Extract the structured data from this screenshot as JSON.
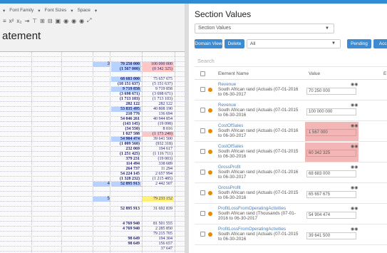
{
  "toolbar": {
    "font_family_label": "Font Family",
    "font_sizes_label": "Font Sizes",
    "space_label": "Space"
  },
  "document": {
    "title": "atement",
    "rows": [
      {
        "c1": "",
        "v1": "",
        "v2": "",
        "h1": "",
        "h2": ""
      },
      {
        "c1": "",
        "v1": "",
        "v2": "",
        "h1": "",
        "h2": ""
      },
      {
        "c1": "3",
        "v1": "70 250 000",
        "v2": "100 000 000",
        "h1": "blue",
        "h2": "pink"
      },
      {
        "c1": "",
        "v1": "(1 567 000)",
        "v2": "(0 342 325)",
        "h1": "blue",
        "h2": "pink"
      },
      {
        "c1": "",
        "v1": "",
        "v2": "",
        "h1": "",
        "h2": ""
      },
      {
        "c1": "",
        "v1": "68 683 000",
        "v2": "75 657 675",
        "h1": "blue",
        "h2": ""
      },
      {
        "c1": "",
        "v1": "(18 151 637)",
        "v2": "(5 151 637)",
        "h1": "",
        "h2": ""
      },
      {
        "c1": "",
        "v1": "9 719 858",
        "v2": "9 719 858",
        "h1": "blue",
        "h2": ""
      },
      {
        "c1": "",
        "v1": "(3 698 671)",
        "v2": "(3 698 671)",
        "h1": "",
        "h2": ""
      },
      {
        "c1": "",
        "v1": "(1 713 103)",
        "v2": "(1 713 103)",
        "h1": "",
        "h2": ""
      },
      {
        "c1": "",
        "v1": "282 122",
        "v2": "282 122",
        "h1": "",
        "h2": ""
      },
      {
        "c1": "",
        "v1": "53 835 495",
        "v2": "40 808 190",
        "h1": "blue",
        "h2": ""
      },
      {
        "c1": "",
        "v1": "210 776",
        "v2": "136 694",
        "h1": "",
        "h2": ""
      },
      {
        "c1": "",
        "v1": "54 046 261",
        "v2": "40 944 854",
        "h1": "",
        "h2": ""
      },
      {
        "c1": "",
        "v1": "(143 145)",
        "v2": "(19 098)",
        "h1": "",
        "h2": ""
      },
      {
        "c1": "",
        "v1": "(34 550)",
        "v2": "8 016",
        "h1": "",
        "h2": ""
      },
      {
        "c1": "",
        "v1": "1 027 588",
        "v2": "(1 173 240)",
        "h1": "",
        "h2": "pink"
      },
      {
        "c1": "",
        "v1": "54 904 474",
        "v2": "39 641 500",
        "h1": "blue",
        "h2": ""
      },
      {
        "c1": "",
        "v1": "(1 009 560)",
        "v2": "(932 318)",
        "h1": "",
        "h2": ""
      },
      {
        "c1": "",
        "v1": "232 069",
        "v2": "194 617",
        "h1": "",
        "h2": ""
      },
      {
        "c1": "",
        "v1": "(1 251 425)",
        "v2": "(1 116 711)",
        "h1": "",
        "h2": ""
      },
      {
        "c1": "",
        "v1": "379 231",
        "v2": "(19 003)",
        "h1": "",
        "h2": ""
      },
      {
        "c1": "",
        "v1": "114 494",
        "v2": "338 689",
        "h1": "",
        "h2": ""
      },
      {
        "c1": "",
        "v1": "264 737",
        "v2": "11 294",
        "h1": "",
        "h2": ""
      },
      {
        "c1": "",
        "v1": "54 224 145",
        "v2": "2 657 994",
        "h1": "",
        "h2": ""
      },
      {
        "c1": "",
        "v1": "(1 328 232)",
        "v2": "(1 215 485)",
        "h1": "",
        "h2": ""
      },
      {
        "c1": "4",
        "v1": "52 895 913",
        "v2": "2 442 507",
        "h1": "blue",
        "h2": ""
      },
      {
        "c1": "",
        "v1": "",
        "v2": "",
        "h1": "",
        "h2": ""
      },
      {
        "c1": "",
        "v1": "",
        "v2": "",
        "h1": "",
        "h2": ""
      },
      {
        "c1": "5",
        "v1": "",
        "v2": "79 233 152",
        "h1": "",
        "h2": "yellow"
      },
      {
        "c1": "",
        "v1": "",
        "v2": "",
        "h1": "",
        "h2": ""
      },
      {
        "c1": "",
        "v1": "52 895 913",
        "v2": "31 692 839",
        "h1": "",
        "h2": ""
      },
      {
        "c1": "",
        "v1": "",
        "v2": "",
        "h1": "",
        "h2": ""
      },
      {
        "c1": "",
        "v1": "",
        "v2": "",
        "h1": "",
        "h2": ""
      },
      {
        "c1": "",
        "v1": "4 769 940",
        "v2": "81 501 555",
        "h1": "",
        "h2": ""
      },
      {
        "c1": "",
        "v1": "4 769 940",
        "v2": "2 285 850",
        "h1": "",
        "h2": ""
      },
      {
        "c1": "",
        "v1": "",
        "v2": "79 215 705",
        "h1": "",
        "h2": ""
      },
      {
        "c1": "",
        "v1": "98 649",
        "v2": "194 304",
        "h1": "",
        "h2": ""
      },
      {
        "c1": "",
        "v1": "98 649",
        "v2": "156 657",
        "h1": "",
        "h2": ""
      },
      {
        "c1": "",
        "v1": "",
        "v2": "37 647",
        "h1": "",
        "h2": ""
      }
    ]
  },
  "panel": {
    "title": "Section Values",
    "section_select": "Section Values",
    "buttons": {
      "domain_view": "Domain View",
      "delete": "Delete",
      "pending": "Pending",
      "accept": "Acce"
    },
    "filter_select": "All",
    "search_placeholder": "Search",
    "columns": {
      "element_name": "Element Name",
      "value": "Value",
      "extra": "E"
    },
    "rows": [
      {
        "name": "Revenue",
        "desc": "South African rand (Actuals (07-01-2016 to 06-30-2017",
        "value": "70 250 000",
        "red": false
      },
      {
        "name": "Revenue",
        "desc": "South African rand (Actuals (07-01-2015 to 06-30-2016",
        "value": "100 000 000",
        "red": false
      },
      {
        "name": "CostOfSales",
        "desc": "South African rand (Actuals (07-01-2016 to 06-30-2017",
        "value": "1 567 000",
        "red": true
      },
      {
        "name": "CostOfSales",
        "desc": "South African rand (Actuals (07-01-2015 to 06-30-2016",
        "value": "60 342 325",
        "red": true
      },
      {
        "name": "GrossProfit",
        "desc": "South African rand (Actuals (07-01-2016 to 06-30-2017",
        "value": "68 683 000",
        "red": false
      },
      {
        "name": "GrossProfit",
        "desc": "South African rand (Actuals (07-01-2015 to 06-30-2016",
        "value": "65 657 675",
        "red": false
      },
      {
        "name": "ProfitLossFromOperatingActivities",
        "desc": "South African rand (Thousands (07-01-2016 to 06-30-2017",
        "value": "54 904 474",
        "red": false
      },
      {
        "name": "ProfitLossFromOperatingActivities",
        "desc": "South African rand (Actuals (07-01-2015 to 06-30-2016",
        "value": "39 641 500",
        "red": false
      }
    ]
  }
}
